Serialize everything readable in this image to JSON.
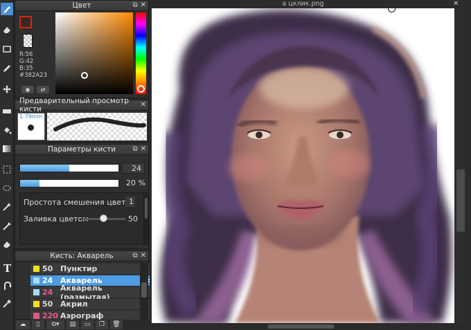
{
  "document": {
    "title": "а цклик.png"
  },
  "color_panel": {
    "title": "Цвет",
    "r_label": "R:56",
    "g_label": "G:42",
    "b_label": "B:35",
    "hex": "#382A23",
    "primary_color": "#382A23",
    "hue_color": "#ff8a00"
  },
  "brush_preview": {
    "title": "Предварительный просмотр кисти",
    "size_label": "1.79mm"
  },
  "brush_params": {
    "title": "Параметры кисти",
    "size_value": "24",
    "size_fraction": 0.5,
    "opacity_value": "20 %",
    "opacity_fraction": 0.2,
    "blend_label": "Простота смешения цветов",
    "blend_value": "1",
    "fill_label": "Заливка цветом",
    "fill_value": "50",
    "fill_fraction": 0.5
  },
  "brush_list": {
    "title": "Кисть: Акварель",
    "items": [
      {
        "size": "50",
        "name": "Пунктир",
        "swatch": "#f2df1c",
        "selected": false
      },
      {
        "size": "24",
        "name": "Акварель",
        "swatch": "#a6dcf2",
        "selected": true
      },
      {
        "size": "24",
        "name": "Акварель (размытая)",
        "swatch": "#a6dcf2",
        "selected": false
      },
      {
        "size": "50",
        "name": "Акрил",
        "swatch": "#f2df1c",
        "selected": false
      },
      {
        "size": "220",
        "name": "Аэрограф",
        "swatch": "#d85a8a",
        "selected": false
      }
    ]
  },
  "icons": {
    "toolbar": [
      "brush-icon",
      "eraser-icon",
      "rectangle-icon",
      "pencil-icon",
      "move-icon",
      "shape-icon",
      "fill-icon",
      "gradient-icon",
      "select-icon",
      "lasso-icon",
      "magic-wand-icon",
      "crop-icon",
      "stamp-icon",
      "text-icon",
      "smudge-icon",
      "eyedropper-icon"
    ]
  }
}
